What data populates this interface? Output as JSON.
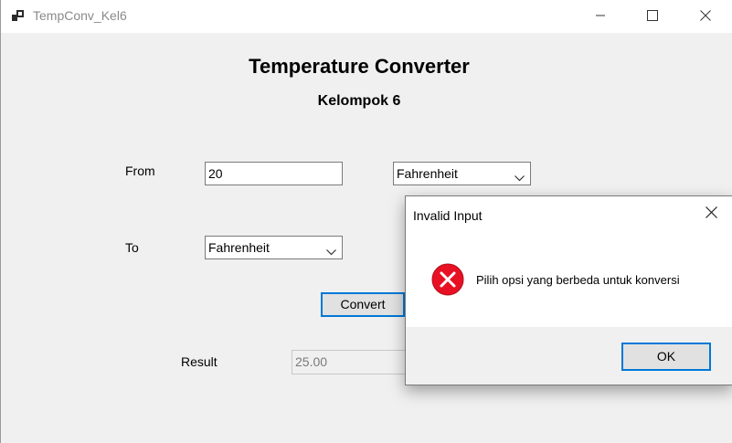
{
  "window": {
    "title": "TempConv_Kel6",
    "controls": {
      "minimize_icon": "minimize-icon",
      "maximize_icon": "maximize-icon",
      "close_icon": "close-icon"
    }
  },
  "form": {
    "heading": "Temperature Converter",
    "subheading": "Kelompok 6",
    "from_label": "From",
    "from_value": "20",
    "from_unit": "Fahrenheit",
    "to_label": "To",
    "to_unit": "Fahrenheit",
    "convert_label": "Convert",
    "result_label": "Result",
    "result_value": "25.00"
  },
  "dialog": {
    "title": "Invalid Input",
    "message": "Pilih opsi yang berbeda untuk konversi",
    "ok_label": "OK",
    "icon": "error-icon"
  },
  "colors": {
    "focus_accent": "#0078d7",
    "error_red": "#e81123",
    "window_bg": "#f0f0f0"
  }
}
